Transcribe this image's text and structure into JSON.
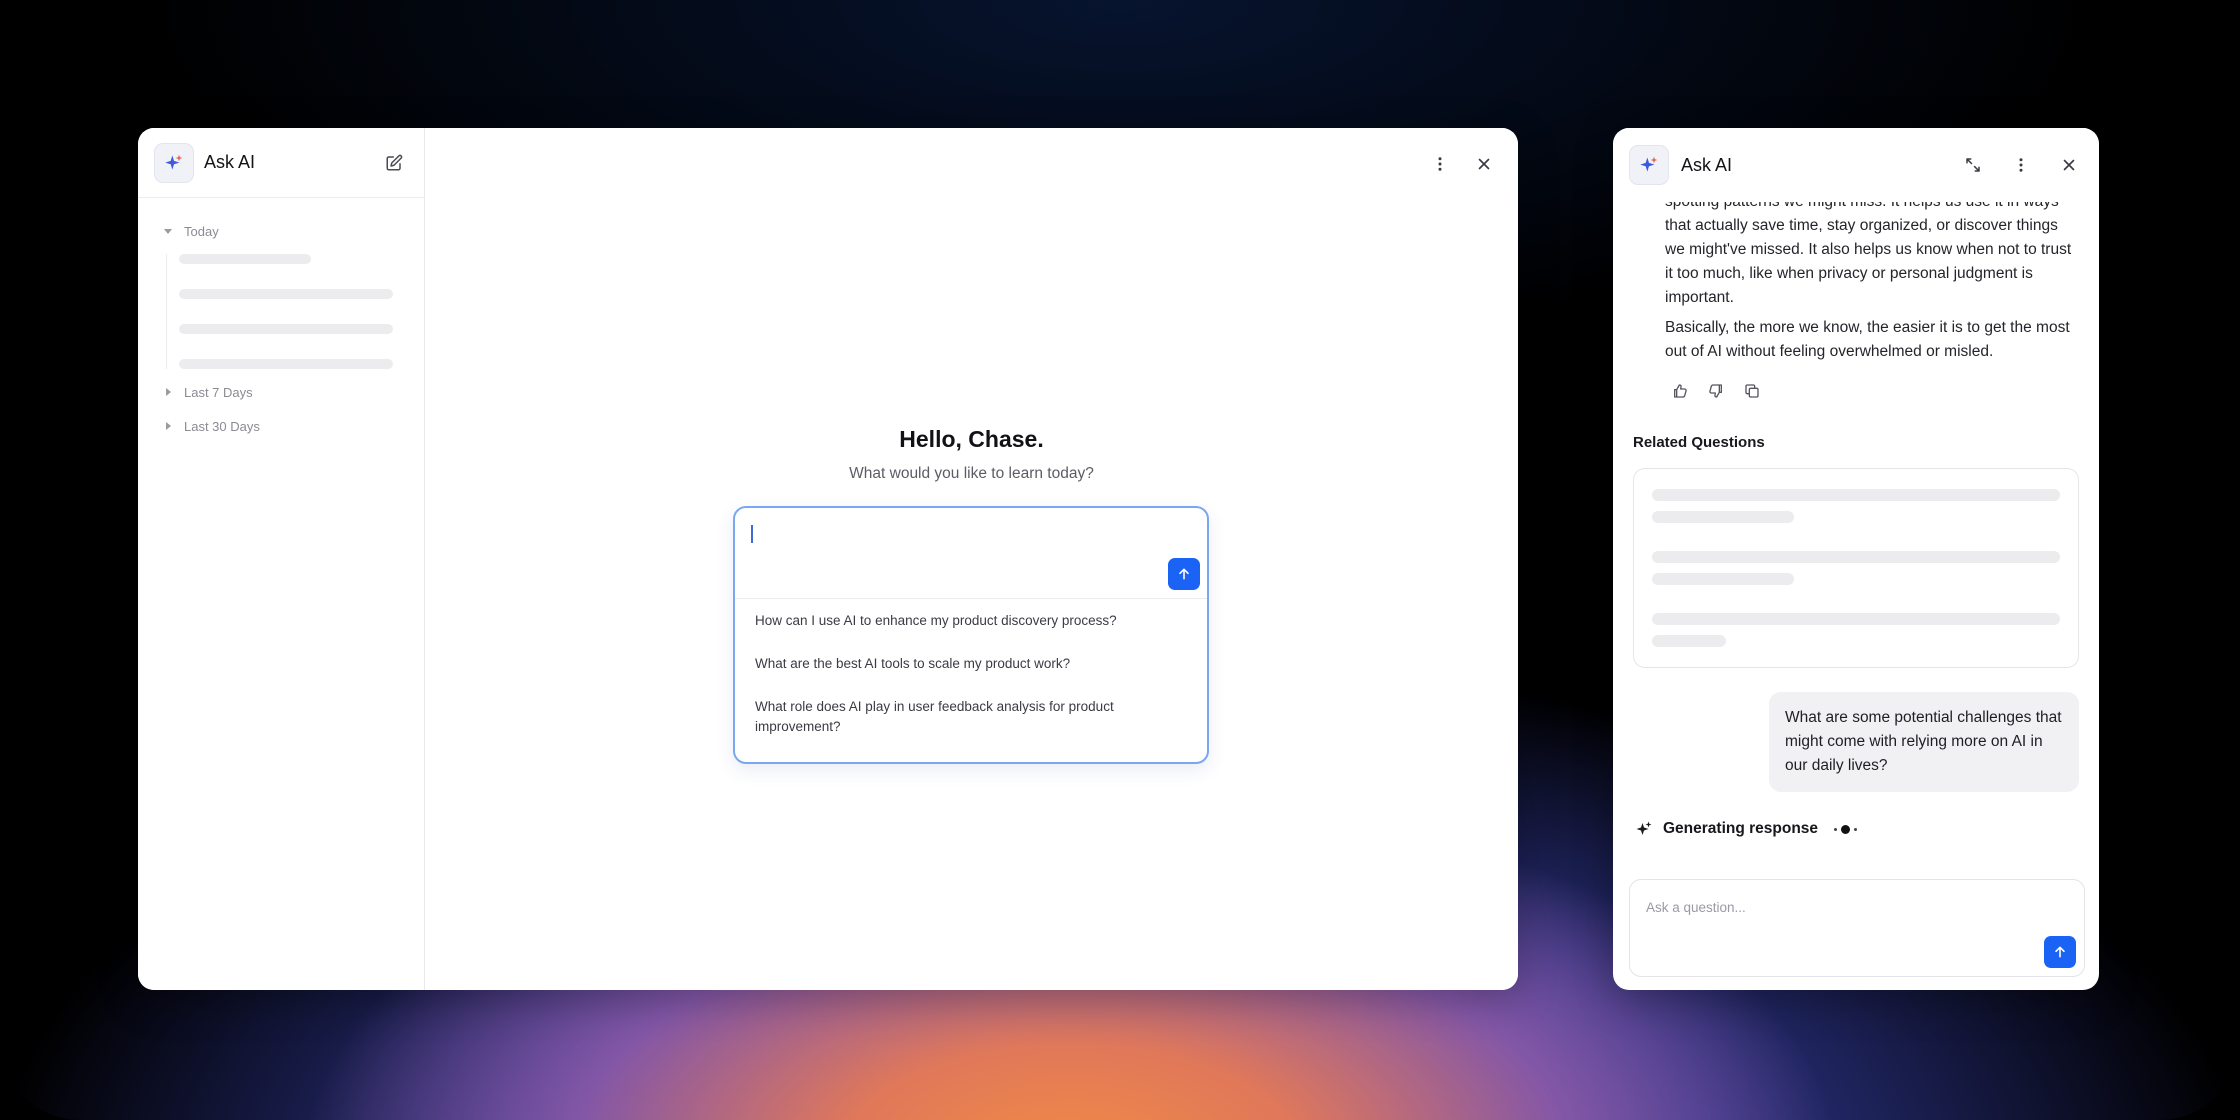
{
  "brand": {
    "accent": "#1a63f5",
    "logo_icon": "sparkle-icon"
  },
  "left_app": {
    "sidebar": {
      "title": "Ask AI",
      "compose_icon": "edit-icon",
      "groups": [
        {
          "label": "Today",
          "expanded": true
        },
        {
          "label": "Last 7 Days",
          "expanded": false
        },
        {
          "label": "Last 30 Days",
          "expanded": false
        }
      ]
    },
    "toolbar": {
      "more_icon": "more-vertical-icon",
      "close_icon": "close-icon"
    },
    "greeting": {
      "title": "Hello, Chase.",
      "subtitle": "What would you like to learn today?"
    },
    "composer": {
      "value": "",
      "send_icon": "arrow-up-icon"
    },
    "suggestions": [
      "How can I use AI to enhance my product discovery process?",
      "What are the best AI tools to scale my product work?",
      "What role does AI play in user feedback analysis for product improvement?"
    ]
  },
  "side_panel": {
    "title": "Ask AI",
    "tools": [
      "expand-icon",
      "more-vertical-icon",
      "close-icon"
    ],
    "answer": {
      "paragraph_1": "spotting patterns we might miss. It helps us use it in ways that actually save time, stay organized, or discover things we might've missed. It also helps us know when not to trust it too much, like when privacy or personal judgment is important.",
      "paragraph_2": "Basically, the more we know, the easier it is to get the most out of AI without feeling overwhelmed or misled."
    },
    "feedback_icons": [
      "thumbs-up-icon",
      "thumbs-down-icon",
      "copy-icon"
    ],
    "related_questions_title": "Related Questions",
    "user_message": "What are some potential challenges that might come with relying more on AI in our daily lives?",
    "status": "Generating response",
    "input": {
      "placeholder": "Ask a question..."
    }
  }
}
